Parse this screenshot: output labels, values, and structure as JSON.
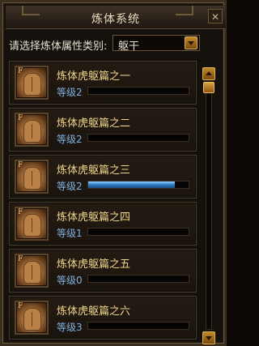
{
  "window": {
    "title": "炼体系统",
    "close_glyph": "✕"
  },
  "filter": {
    "label": "请选择炼体属性类别:",
    "selected": "躯干"
  },
  "items": [
    {
      "name": "炼体虎躯篇之一",
      "level_label": "等级2",
      "progress": 0,
      "icon": "torso-icon",
      "icon_letter": "F"
    },
    {
      "name": "炼体虎躯篇之二",
      "level_label": "等级2",
      "progress": 0,
      "icon": "torso-icon",
      "icon_letter": "F"
    },
    {
      "name": "炼体虎躯篇之三",
      "level_label": "等级2",
      "progress": 0.86,
      "icon": "torso-icon",
      "icon_letter": "F"
    },
    {
      "name": "炼体虎躯篇之四",
      "level_label": "等级1",
      "progress": 0,
      "icon": "torso-icon",
      "icon_letter": "F"
    },
    {
      "name": "炼体虎躯篇之五",
      "level_label": "等级0",
      "progress": 0,
      "icon": "torso-icon",
      "icon_letter": "F"
    },
    {
      "name": "炼体虎躯篇之六",
      "level_label": "等级3",
      "progress": 0,
      "icon": "torso-icon",
      "icon_letter": "F"
    }
  ],
  "scroll": {
    "position": 0
  },
  "colors": {
    "name_text": "#f0d68a",
    "level_text": "#7fb0e0",
    "accent_gold": "#c08a2a"
  }
}
